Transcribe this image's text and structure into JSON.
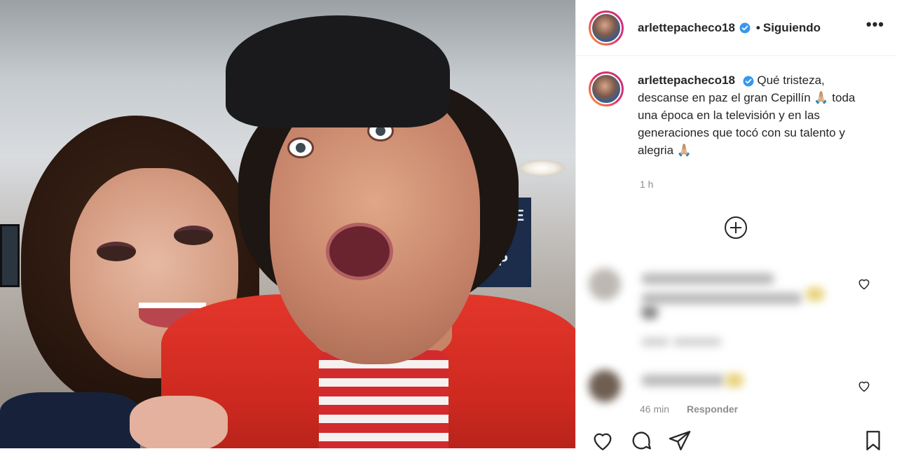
{
  "post": {
    "username": "arlettepacheco18",
    "follow_status": "Siguiendo",
    "separator": "•",
    "more_label": "•••",
    "caption": "Qué tristeza, descanse en paz el gran Cepillín 🙏🏼 toda una época en la televisión y en las generaciones que tocó con su talento y alegria 🙏🏼",
    "time": "1 h"
  },
  "photo": {
    "sign_text": "NTE\nIO\n.P"
  },
  "comments": [
    {
      "time": "",
      "reply": ""
    },
    {
      "time": "46 min",
      "reply": "Responder"
    }
  ],
  "icons": {
    "verified": "verified-badge-icon",
    "more": "more-options-icon",
    "load_more": "plus-circle-icon",
    "like": "heart-icon",
    "comment": "comment-icon",
    "share": "paper-plane-icon",
    "save": "bookmark-icon"
  },
  "colors": {
    "accent": "#3897f0",
    "text": "#262626",
    "muted": "#8e8e8e",
    "border": "#efefef"
  }
}
